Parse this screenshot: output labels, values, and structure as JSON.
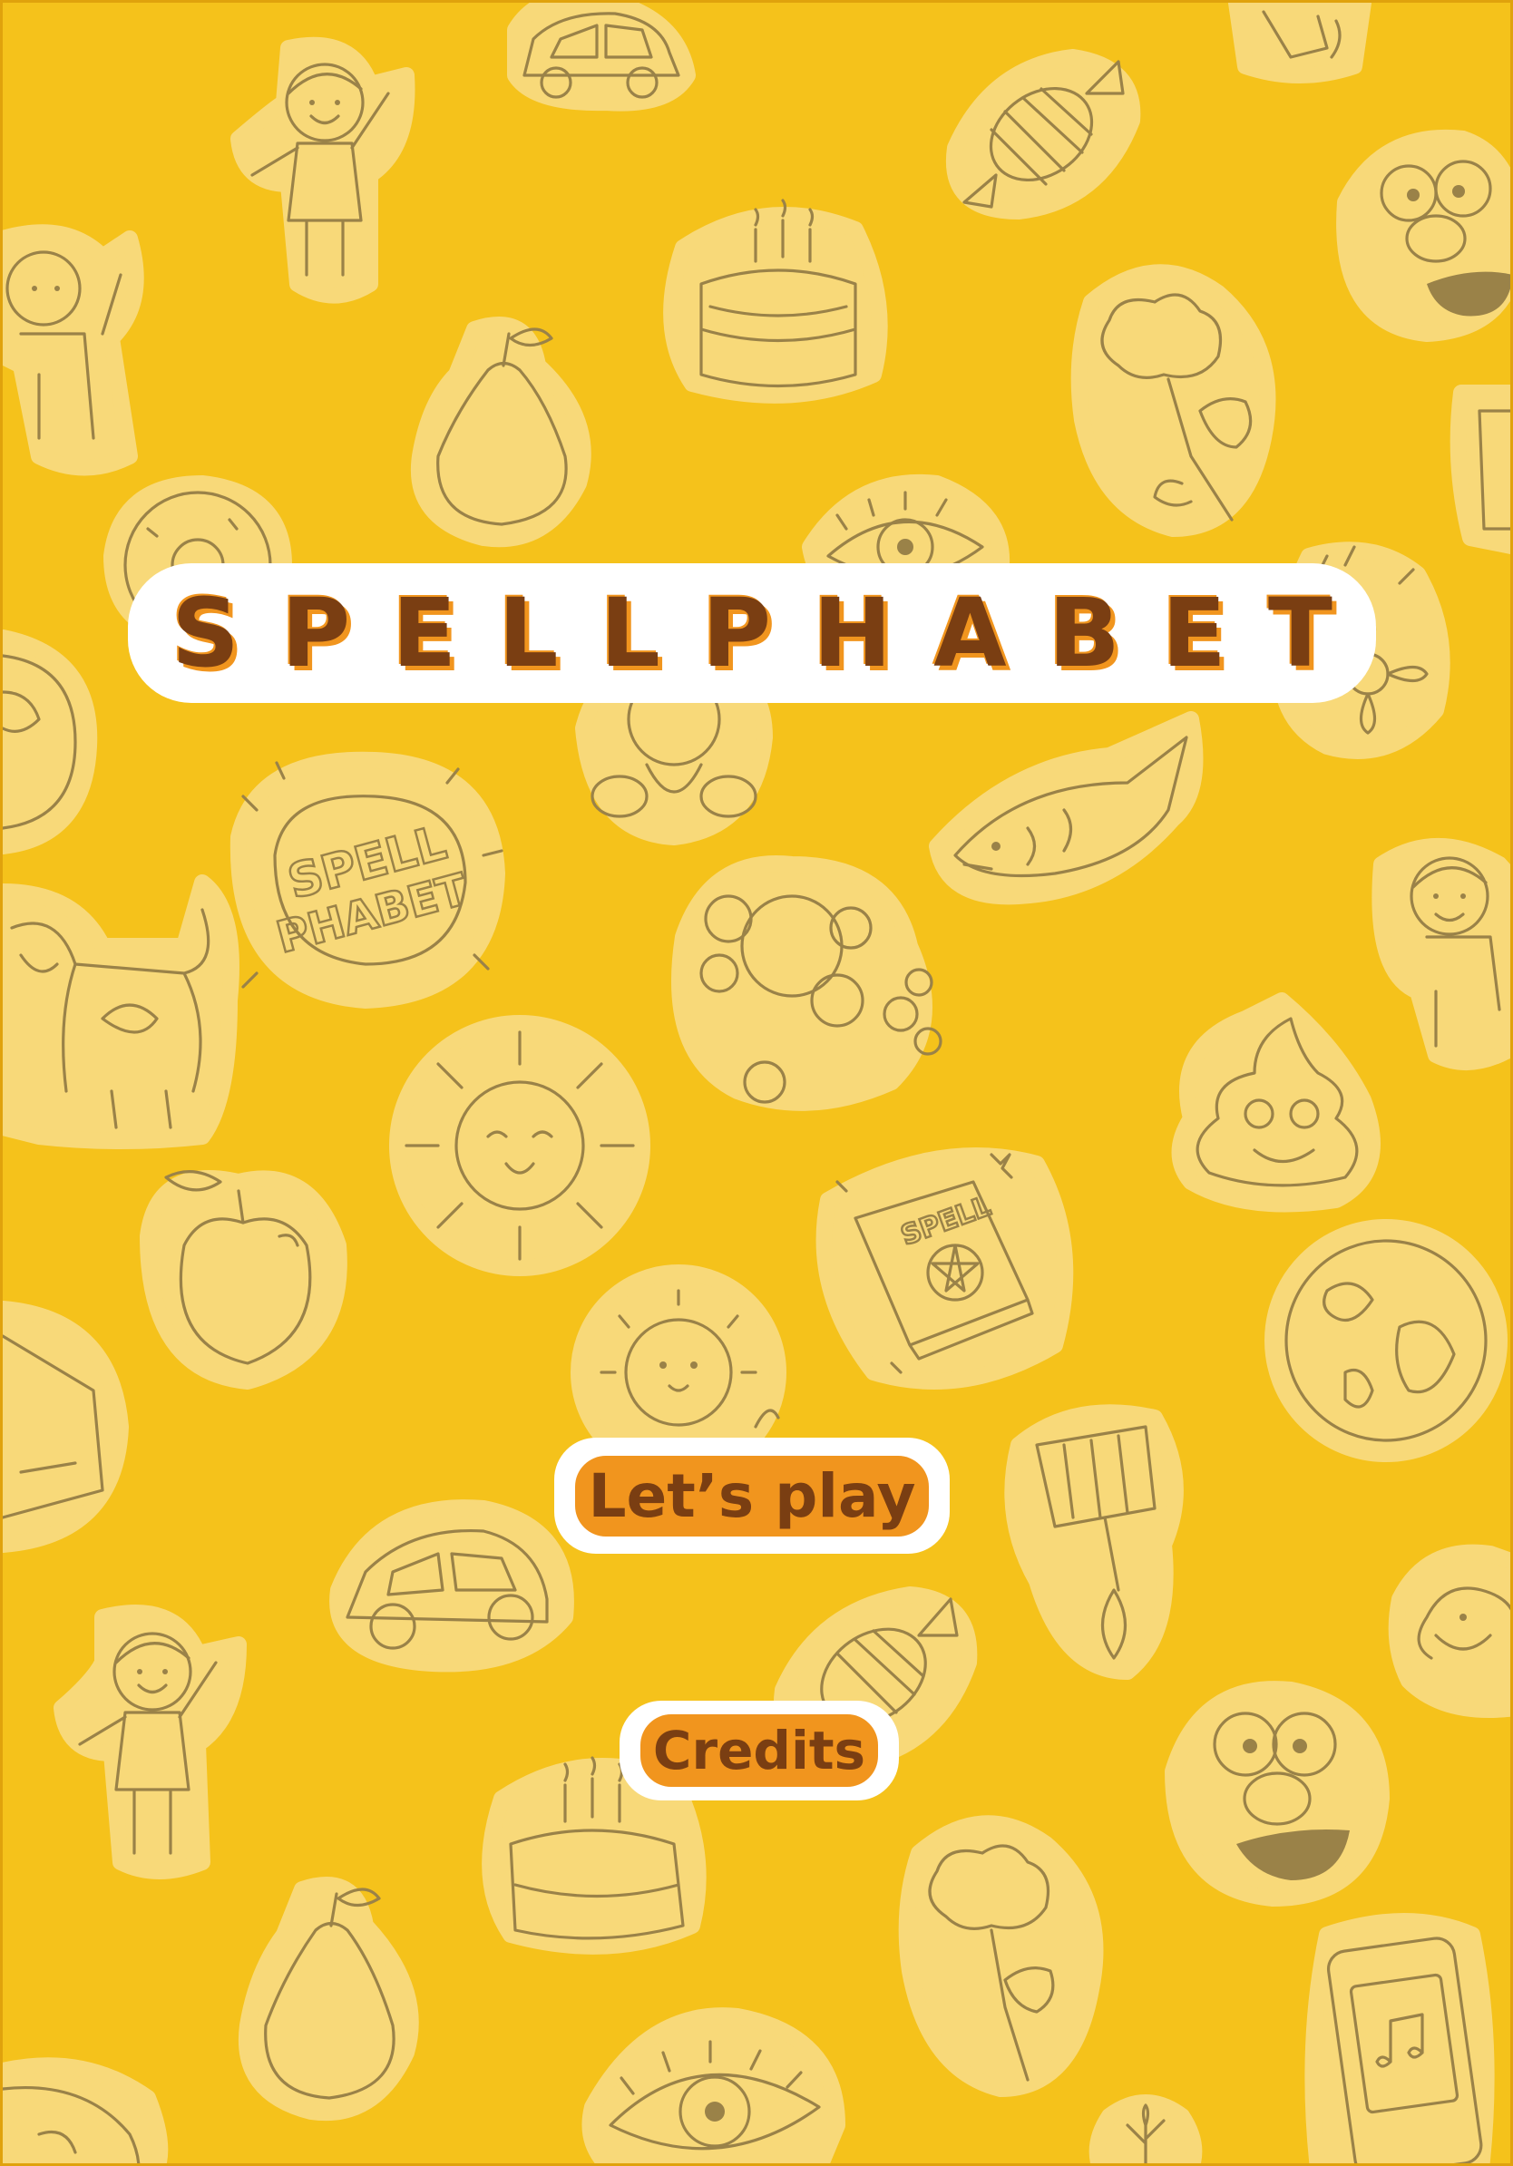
{
  "app": {
    "title": "SPELLPHABET"
  },
  "background": {
    "color": "#f5c21b",
    "sticker_color": "#f8d979",
    "line_color": "#9a8248",
    "doodle_text_1": "SPELL",
    "doodle_text_2": "PHABET",
    "book_text": "SPELL",
    "stickers": [
      "car-icon",
      "candy-icon",
      "girl-icon",
      "cake-icon",
      "monster-icon",
      "tree-icon",
      "pear-icon",
      "donut-icon",
      "eye-icon",
      "globe-icon",
      "flower-icon",
      "bear-icon",
      "fish-icon",
      "badge-icon",
      "dog-icon",
      "bubbles-icon",
      "sun-icon",
      "poop-icon",
      "apple-icon",
      "spellbook-icon",
      "lion-icon",
      "lamp-icon",
      "phone-icon"
    ]
  },
  "menu": {
    "play_label": "Let’s play",
    "credits_label": "Credits"
  },
  "colors": {
    "title_text": "#7a3e12",
    "title_shadow": "#f1951e",
    "button_fill": "#f1951e",
    "button_outline": "#ffffff"
  }
}
